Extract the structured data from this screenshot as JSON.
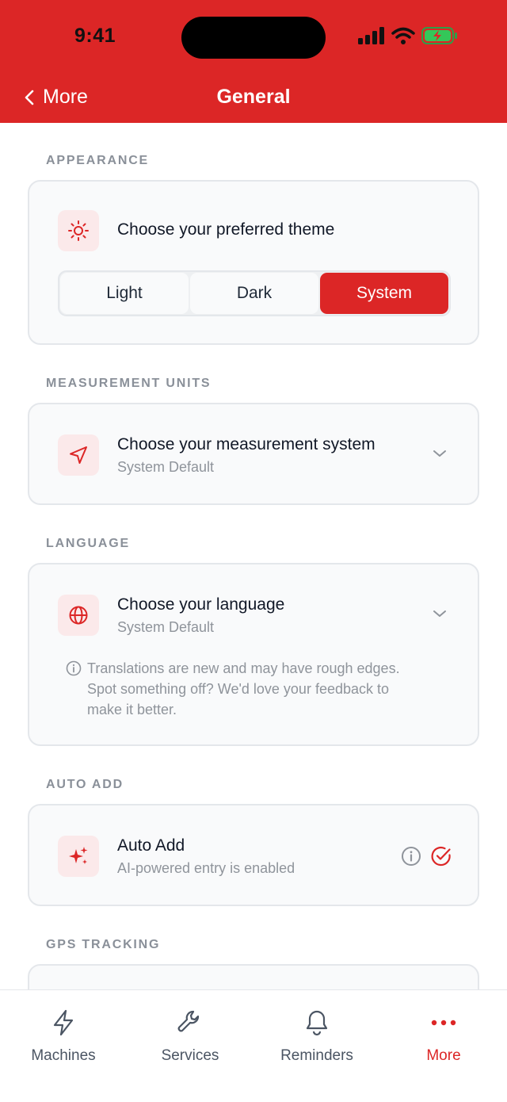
{
  "status_bar": {
    "time": "9:41"
  },
  "nav": {
    "back_label": "More",
    "title": "General"
  },
  "appearance": {
    "section_title": "APPEARANCE",
    "title": "Choose your preferred theme",
    "options": [
      "Light",
      "Dark",
      "System"
    ],
    "selected": "System"
  },
  "units": {
    "section_title": "MEASUREMENT UNITS",
    "title": "Choose your measurement system",
    "value": "System Default"
  },
  "language": {
    "section_title": "LANGUAGE",
    "title": "Choose your language",
    "value": "System Default",
    "note_line1": "Translations are new and may have rough edges.",
    "note_line2": "Spot something off? We'd love your feedback to",
    "note_line3": "make it better."
  },
  "auto_add": {
    "section_title": "AUTO ADD",
    "title": "Auto Add",
    "subtitle": "AI-powered entry is enabled"
  },
  "gps": {
    "section_title": "GPS TRACKING"
  },
  "tabbar": {
    "machines": "Machines",
    "services": "Services",
    "reminders": "Reminders",
    "more": "More"
  },
  "colors": {
    "accent": "#dc2626",
    "battery": "#34c759"
  }
}
